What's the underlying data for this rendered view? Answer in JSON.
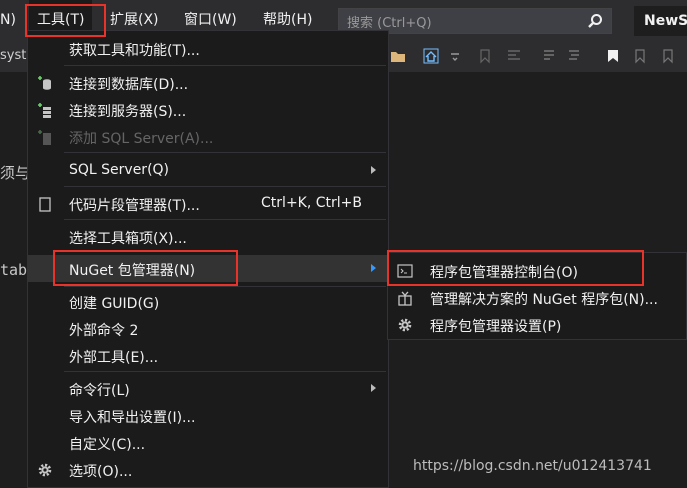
{
  "menubar": {
    "items": [
      {
        "label": "N)",
        "name": "menu-partial"
      },
      {
        "label": "工具(T)",
        "name": "menu-tools"
      },
      {
        "label": "扩展(X)",
        "name": "menu-extensions"
      },
      {
        "label": "窗口(W)",
        "name": "menu-window"
      },
      {
        "label": "帮助(H)",
        "name": "menu-help"
      }
    ],
    "search_placeholder": "搜索 (Ctrl+Q)",
    "solution_name": "NewS"
  },
  "toolbar": {
    "left_text": "syste"
  },
  "editor": {
    "fragment1": "须与",
    "fragment2": "tab"
  },
  "tools_menu": {
    "items": [
      {
        "label": "获取工具和功能(T)...",
        "shortcut": "",
        "icon": "",
        "disabled": false,
        "submenu": false
      },
      {
        "label": "连接到数据库(D)...",
        "shortcut": "",
        "icon": "database-plus-icon",
        "disabled": false,
        "submenu": false
      },
      {
        "label": "连接到服务器(S)...",
        "shortcut": "",
        "icon": "server-plus-icon",
        "disabled": false,
        "submenu": false
      },
      {
        "label": "添加 SQL Server(A)...",
        "shortcut": "",
        "icon": "sql-server-add-icon",
        "disabled": true,
        "submenu": false
      },
      {
        "label": "SQL Server(Q)",
        "shortcut": "",
        "icon": "",
        "disabled": false,
        "submenu": true
      },
      {
        "label": "代码片段管理器(T)...",
        "shortcut": "Ctrl+K, Ctrl+B",
        "icon": "snippet-icon",
        "disabled": false,
        "submenu": false
      },
      {
        "label": "选择工具箱项(X)...",
        "shortcut": "",
        "icon": "",
        "disabled": false,
        "submenu": false
      },
      {
        "label": "NuGet 包管理器(N)",
        "shortcut": "",
        "icon": "",
        "disabled": false,
        "submenu": true
      },
      {
        "label": "创建 GUID(G)",
        "shortcut": "",
        "icon": "",
        "disabled": false,
        "submenu": false
      },
      {
        "label": "外部命令 2",
        "shortcut": "",
        "icon": "",
        "disabled": false,
        "submenu": false
      },
      {
        "label": "外部工具(E)...",
        "shortcut": "",
        "icon": "",
        "disabled": false,
        "submenu": false
      },
      {
        "label": "命令行(L)",
        "shortcut": "",
        "icon": "",
        "disabled": false,
        "submenu": true
      },
      {
        "label": "导入和导出设置(I)...",
        "shortcut": "",
        "icon": "",
        "disabled": false,
        "submenu": false
      },
      {
        "label": "自定义(C)...",
        "shortcut": "",
        "icon": "",
        "disabled": false,
        "submenu": false
      },
      {
        "label": "选项(O)...",
        "shortcut": "",
        "icon": "gear-icon",
        "disabled": false,
        "submenu": false
      }
    ]
  },
  "nuget_submenu": {
    "items": [
      {
        "label": "程序包管理器控制台(O)",
        "icon": "console-icon"
      },
      {
        "label": "管理解决方案的 NuGet 程序包(N)...",
        "icon": "package-icon"
      },
      {
        "label": "程序包管理器设置(P)",
        "icon": "gear-icon"
      }
    ]
  },
  "watermark": "https://blog.csdn.net/u012413741",
  "colors": {
    "highlight": "#e8332b",
    "menu_bg": "#1b1b1c",
    "bar_bg": "#2d2d30",
    "submenu_arrow_active": "#3399ff"
  }
}
